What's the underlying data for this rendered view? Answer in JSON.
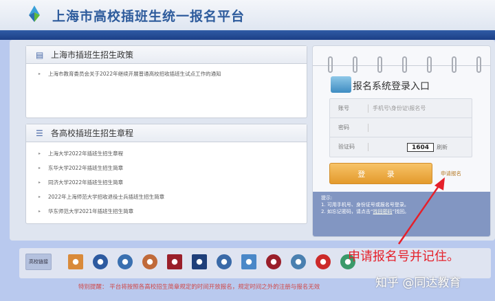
{
  "header": {
    "title": "上海市高校插班生统一报名平台"
  },
  "policy": {
    "title": "上海市插班生招生政策",
    "items": [
      "上海市教育委员会关于2022年继续开展普通高校招收插班生试点工作的通知"
    ]
  },
  "charters": {
    "title": "各高校插班生招生章程",
    "items": [
      "上海大学2022年插班生招生章程",
      "东华大学2022年插班生招生简章",
      "同济大学2022年插班生招生简章",
      "2022年上海师范大学招收退役士兵插班生招生简章",
      "华东师范大学2021年插班生招生简章"
    ]
  },
  "login": {
    "title": "报名系统登录入口",
    "account_label": "账号",
    "account_placeholder": "手机号\\身份证\\报名号",
    "password_label": "密码",
    "captcha_label": "验证码",
    "captcha_code": "1604",
    "refresh": "刷新",
    "login_button": "登 录",
    "apply_link": "申请报名",
    "hint_title": "提示:",
    "hint_1": "1. 可用手机号、身份证号或报名号登录。",
    "hint_2_pre": "2. 如忘记密码，请点击“",
    "hint_2_link": "找回密码",
    "hint_2_post": "”找回。"
  },
  "links": {
    "label": "高校链接",
    "badge_colors": [
      "#d98a3a",
      "#2d5aa0",
      "#3a70b0",
      "#c06a3a",
      "#9a1f2a",
      "#1f3f7a",
      "#3a6aa8",
      "#4a88c8",
      "#9a1f2a",
      "#4a80b0",
      "#cc2a2a",
      "#3a9a6a"
    ]
  },
  "footer": {
    "notice": "特别提醒：  平台将按照各高校招生简章规定的时间开放报名，规定时间之外的注册与报名无效"
  },
  "annotation": {
    "text": "申请报名号并记住。"
  },
  "watermark": {
    "text": "知乎 @同达教育"
  }
}
